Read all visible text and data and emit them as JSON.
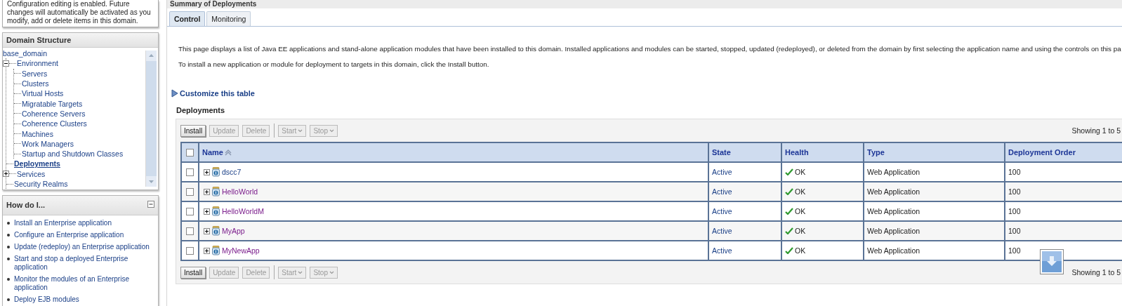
{
  "change_center": {
    "message": "Configuration editing is enabled. Future changes will automatically be activated as you modify, add or delete items in this domain."
  },
  "domain_structure": {
    "title": "Domain Structure",
    "tree": {
      "label": "base_domain",
      "selected": false,
      "children": [
        {
          "label": "Environment",
          "selected": false,
          "expanded": true,
          "children": [
            {
              "label": "Servers",
              "selected": false
            },
            {
              "label": "Clusters",
              "selected": false
            },
            {
              "label": "Virtual Hosts",
              "selected": false
            },
            {
              "label": "Migratable Targets",
              "selected": false
            },
            {
              "label": "Coherence Servers",
              "selected": false
            },
            {
              "label": "Coherence Clusters",
              "selected": false
            },
            {
              "label": "Machines",
              "selected": false
            },
            {
              "label": "Work Managers",
              "selected": false
            },
            {
              "label": "Startup and Shutdown Classes",
              "selected": false
            }
          ]
        },
        {
          "label": "Deployments",
          "selected": true
        },
        {
          "label": "Services",
          "selected": false,
          "expanded": false
        },
        {
          "label": "Security Realms",
          "selected": false
        }
      ]
    }
  },
  "how_do_i": {
    "title": "How do I...",
    "expanded": true,
    "links": [
      "Install an Enterprise application",
      "Configure an Enterprise application",
      "Update (redeploy) an Enterprise application",
      "Start and stop a deployed Enterprise application",
      "Monitor the modules of an Enterprise application",
      "Deploy EJB modules"
    ]
  },
  "summary": {
    "title": "Summary of Deployments",
    "tabs": [
      {
        "label": "Control",
        "selected": true
      },
      {
        "label": "Monitoring",
        "selected": false
      }
    ],
    "description": [
      "This page displays a list of Java EE applications and stand-alone application modules that have been installed to this domain. Installed applications and modules can be started, stopped, updated (redeployed), or deleted from the domain by first selecting the application name and using the controls on this pa",
      "To install a new application or module for deployment to targets in this domain, click the Install button."
    ],
    "customize_link": "Customize this table",
    "table_title": "Deployments",
    "toolbar_top": [
      {
        "label": "Install",
        "kind": "button",
        "disabled": false
      },
      {
        "label": "Update",
        "kind": "button",
        "disabled": true
      },
      {
        "label": "Delete",
        "kind": "button",
        "disabled": true
      },
      {
        "label": "Start",
        "kind": "menu",
        "disabled": true
      },
      {
        "label": "Stop",
        "kind": "menu",
        "disabled": true
      }
    ],
    "toolbar_bottom": [
      {
        "label": "Install",
        "kind": "button",
        "disabled": false
      },
      {
        "label": "Update",
        "kind": "button",
        "disabled": true
      },
      {
        "label": "Delete",
        "kind": "button",
        "disabled": true
      },
      {
        "label": "Start",
        "kind": "menu",
        "disabled": true
      },
      {
        "label": "Stop",
        "kind": "menu",
        "disabled": true
      }
    ],
    "pagination_top": "Showing 1 to 5",
    "pagination_bottom": "Showing 1 to 5",
    "select_all_checked": false,
    "columns": [
      {
        "label": "Name",
        "sorted": true
      },
      {
        "label": "State",
        "sorted": false
      },
      {
        "label": "Health",
        "sorted": false
      },
      {
        "label": "Type",
        "sorted": false
      },
      {
        "label": "Deployment Order",
        "sorted": false
      }
    ],
    "rows": [
      {
        "checked": false,
        "name": "dscc7",
        "visited": false,
        "state": "Active",
        "health": "OK",
        "type": "Web Application",
        "order": "100"
      },
      {
        "checked": false,
        "name": "HelloWorld",
        "visited": true,
        "state": "Active",
        "health": "OK",
        "type": "Web Application",
        "order": "100"
      },
      {
        "checked": false,
        "name": "HelloWorldM",
        "visited": true,
        "state": "Active",
        "health": "OK",
        "type": "Web Application",
        "order": "100"
      },
      {
        "checked": false,
        "name": "MyApp",
        "visited": true,
        "state": "Active",
        "health": "OK",
        "type": "Web Application",
        "order": "100"
      },
      {
        "checked": false,
        "name": "MyNewApp",
        "visited": true,
        "state": "Active",
        "health": "OK",
        "type": "Web Application",
        "order": "100"
      }
    ]
  }
}
